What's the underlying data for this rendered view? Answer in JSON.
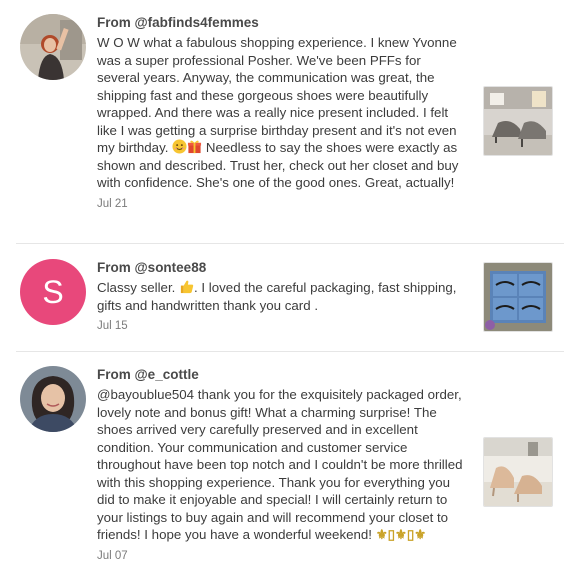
{
  "reviews": [
    {
      "from_prefix": "From ",
      "handle": "@fabfinds4femmes",
      "avatar": "photo",
      "text_part1": "W O W what a fabulous shopping experience. I knew Yvonne was a super professional Posher. We've been PFFs for several years. Anyway, the communication was great, the shipping fast and these gorgeous shoes were beautifully wrapped. And there was a really nice present included. I felt like I was getting a surprise birthday present and it's not even my birthday. ",
      "emoji1": "smiling-face-icon",
      "emoji2": "gift-icon",
      "text_part2": " Needless to say the shoes were exactly as shown and described. Trust her, check out her closet and buy with confidence. She's one of the good ones. Great, actually!",
      "date": "Jul 21",
      "thumb": "grey-heels-photo"
    },
    {
      "from_prefix": "From ",
      "handle": "@sontee88",
      "avatar": "letter",
      "avatar_letter": "S",
      "avatar_color": "#e8487b",
      "text_part1": "Classy seller. ",
      "emoji1": "thumbs-up-icon",
      "text_part2": ". I loved the careful packaging, fast shipping, gifts and handwritten thank you card .",
      "date": "Jul 15",
      "thumb": "eyelashes-product-photo"
    },
    {
      "from_prefix": "From ",
      "handle": "@e_cottle",
      "avatar": "photo",
      "text_part1": "@bayoublue504 thank you for the exquisitely packaged order, lovely note and bonus gift! What a charming surprise! The shoes arrived very carefully preserved and in excellent condition. Your communication and customer service throughout have been top notch and I couldn't be more thrilled with this shopping experience. Thank you for everything you did to make it enjoyable and special! I will certainly return to your listings to buy again and will recommend your closet to friends! I hope you have a wonderful weekend! ",
      "fleurs": "⚜▯⚜▯⚜",
      "date": "Jul 07",
      "thumb": "nude-heels-photo"
    }
  ],
  "colors": {
    "avatar_pink": "#e8487b",
    "text": "#3c3c3c",
    "date": "#7b7b7b",
    "divider": "#e6e6e6"
  }
}
